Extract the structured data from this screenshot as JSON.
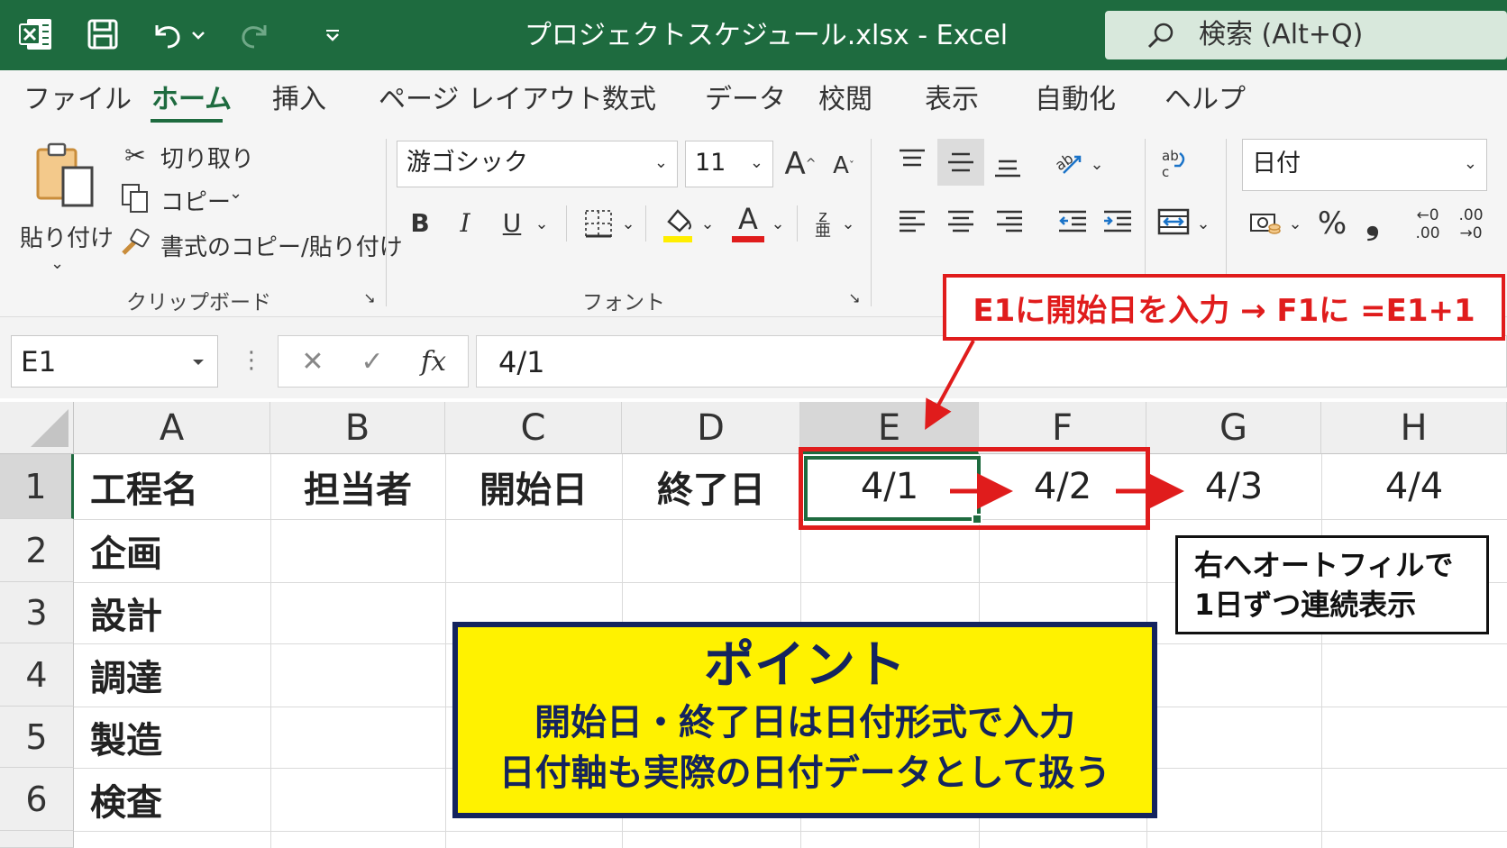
{
  "titlebar": {
    "title": "プロジェクトスケジュール.xlsx  -  Excel",
    "search_label": "検索 (Alt+Q)",
    "icons": [
      "excel-logo-icon",
      "save-icon",
      "undo-icon",
      "redo-icon",
      "customize-qat-icon",
      "search-icon"
    ]
  },
  "menu": {
    "items": [
      "ファイル",
      "ホーム",
      "挿入",
      "ページ レイアウト",
      "数式",
      "データ",
      "校閲",
      "表示",
      "自動化",
      "ヘルプ"
    ],
    "active": "ホーム"
  },
  "ribbon": {
    "clipboard": {
      "paste": "貼り付け",
      "cut": "切り取り",
      "copy": "コピー",
      "format_painter": "書式のコピー/貼り付け",
      "group_label": "クリップボード"
    },
    "font": {
      "font_name": "游ゴシック",
      "font_size": "11",
      "bold": "B",
      "italic": "I",
      "underline": "U",
      "font_color_glyph": "A",
      "group_label": "フォント",
      "highlight_color": "#ffee00",
      "font_color": "#e01c1c"
    },
    "number": {
      "format": "日付",
      "percent": "%",
      "comma": "❟",
      "increase_decimal_top": "←0",
      "increase_decimal_bottom": ".00",
      "decrease_decimal_top": ".00",
      "decrease_decimal_bottom": "→0"
    }
  },
  "formula_bar": {
    "name_box": "E1",
    "formula": "4/1",
    "cancel": "✕",
    "enter": "✓",
    "fx": "fx"
  },
  "sheet": {
    "columns": [
      "A",
      "B",
      "C",
      "D",
      "E",
      "F",
      "G",
      "H"
    ],
    "rows": [
      "1",
      "2",
      "3",
      "4",
      "5",
      "6"
    ],
    "row1": [
      "工程名",
      "担当者",
      "開始日",
      "終了日",
      "4/1",
      "4/2",
      "4/3",
      "4/4"
    ],
    "tasks": [
      "企画",
      "設計",
      "調達",
      "製造",
      "検査"
    ]
  },
  "callouts": {
    "red": "E1に開始日を入力 → F1に =E1+1",
    "black_line1": "右へオートフィルで",
    "black_line2": "1日ずつ連続表示",
    "yellow_title": "ポイント",
    "yellow_line1": "開始日・終了日は日付形式で入力",
    "yellow_line2": "日付軸も実際の日付データとして扱う"
  },
  "colors": {
    "excel_green": "#1e6b3f",
    "accent_red": "#e01c1c",
    "callout_yellow": "#fff200",
    "callout_navy": "#14245e"
  }
}
